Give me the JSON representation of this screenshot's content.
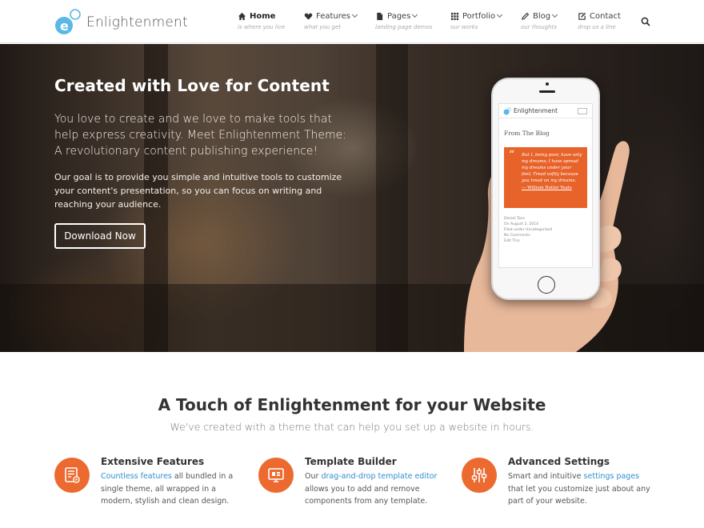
{
  "header": {
    "logo_text": "Enlightenment",
    "nav": [
      {
        "label": "Home",
        "sub": "is where you live",
        "icon": "home-icon",
        "active": true
      },
      {
        "label": "Features",
        "sub": "what you get",
        "icon": "heart-icon"
      },
      {
        "label": "Pages",
        "sub": "landing page demos",
        "icon": "page-icon"
      },
      {
        "label": "Portfolio",
        "sub": "our works",
        "icon": "grid-icon"
      },
      {
        "label": "Blog",
        "sub": "our thoughts",
        "icon": "pencil-icon"
      },
      {
        "label": "Contact",
        "sub": "drop us a line",
        "icon": "edit-icon"
      }
    ],
    "search_icon": "search-icon"
  },
  "hero": {
    "title": "Created with Love for Content",
    "lead": "You love to create and we love to make tools that help express creativity. Meet Enlightenment Theme: A revolutionary content publishing experience!",
    "body": "Our goal is to provide you simple and intuitive tools to customize your content's presentation, so you can focus on writing and reaching your audience.",
    "button": "Download Now",
    "phone": {
      "brand": "Enlightenment",
      "section": "From The Blog",
      "quote": "But I, being poor, have only my dreams; I have spread my dreams under your feet; Tread softly because you tread on my dreams.",
      "quote_author": "William Butler Yeats",
      "meta": [
        "Daniel Tara",
        "On August 2, 2014",
        "Filed under Uncategorized",
        "No Comments",
        "Edit This"
      ]
    }
  },
  "section": {
    "title": "A Touch of Enlightenment for your Website",
    "subtitle": "We've created with a theme that can help you set up a website in hours.",
    "features": [
      {
        "title": "Extensive Features",
        "link": "Countless features",
        "text": " all bundled in a single theme, all wrapped in a modern, stylish and clean design.",
        "icon": "list-settings-icon"
      },
      {
        "title": "Template Builder",
        "pre": "Our ",
        "link": "drag-and-drop template editor",
        "text": " allows you to add and remove components from any template.",
        "icon": "monitor-icon"
      },
      {
        "title": "Advanced Settings",
        "pre": "Smart and intuitive ",
        "link": "settings pages",
        "text": " that let you customize just about any part of your website.",
        "icon": "sliders-icon"
      }
    ]
  },
  "colors": {
    "accent": "#ec6a2f",
    "link": "#2f8fd1",
    "logo": "#5bb8e6"
  }
}
